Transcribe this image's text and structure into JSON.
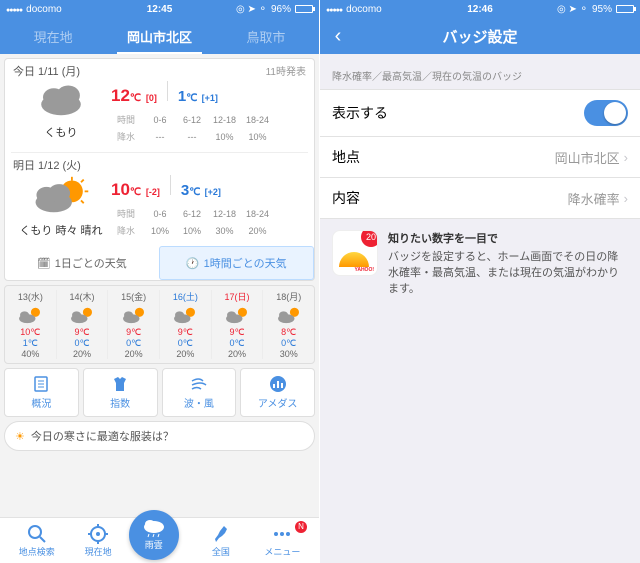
{
  "left": {
    "status": {
      "carrier": "docomo",
      "time": "12:45",
      "battery": "96%"
    },
    "tabs": [
      "現在地",
      "岡山市北区",
      "鳥取市"
    ],
    "today": {
      "hdr": "今日 1/11 (月)",
      "issued": "11時発表",
      "label": "くもり",
      "hi": "12",
      "hi_diff": "[0]",
      "lo": "1",
      "lo_diff": "[+1]",
      "rows": {
        "time_lbl": "時間",
        "pop_lbl": "降水",
        "time": [
          "0-6",
          "6-12",
          "12-18",
          "18-24"
        ],
        "pop": [
          "---",
          "---",
          "10%",
          "10%"
        ]
      }
    },
    "tomorrow": {
      "hdr": "明日 1/12 (火)",
      "label": "くもり 時々 晴れ",
      "hi": "10",
      "hi_diff": "[-2]",
      "lo": "3",
      "lo_diff": "[+2]",
      "rows": {
        "time_lbl": "時間",
        "pop_lbl": "降水",
        "time": [
          "0-6",
          "6-12",
          "12-18",
          "18-24"
        ],
        "pop": [
          "10%",
          "10%",
          "30%",
          "20%"
        ]
      }
    },
    "tabpair": {
      "daily": "1日ごとの天気",
      "hourly": "1時間ごとの天気"
    },
    "week": [
      {
        "d": "13(水)",
        "hi": "10℃",
        "lo": "1℃",
        "pop": "40%",
        "cls": ""
      },
      {
        "d": "14(木)",
        "hi": "9℃",
        "lo": "0℃",
        "pop": "20%",
        "cls": ""
      },
      {
        "d": "15(金)",
        "hi": "9℃",
        "lo": "0℃",
        "pop": "20%",
        "cls": ""
      },
      {
        "d": "16(土)",
        "hi": "9℃",
        "lo": "0℃",
        "pop": "20%",
        "cls": "sat"
      },
      {
        "d": "17(日)",
        "hi": "9℃",
        "lo": "0℃",
        "pop": "20%",
        "cls": "sun"
      },
      {
        "d": "18(月)",
        "hi": "8℃",
        "lo": "0℃",
        "pop": "30%",
        "cls": ""
      }
    ],
    "four": [
      "概況",
      "指数",
      "波・風",
      "アメダス"
    ],
    "banner": "今日の寒さに最適な服装は？",
    "tabbar": [
      "地点検索",
      "現在地",
      "雨雲",
      "全国",
      "メニュー"
    ]
  },
  "right": {
    "status": {
      "carrier": "docomo",
      "time": "12:46",
      "battery": "95%"
    },
    "title": "バッジ設定",
    "section": "降水確率／最高気温／現在の気温のバッジ",
    "cells": {
      "show": "表示する",
      "point_lbl": "地点",
      "point_val": "岡山市北区",
      "content_lbl": "内容",
      "content_val": "降水確率"
    },
    "info": {
      "badge": "20",
      "brand": "YAHOO!",
      "title": "知りたい数字を一目で",
      "body": "バッジを設定すると、ホーム画面でその日の降水確率・最高気温、または現在の気温がわかります。"
    }
  }
}
